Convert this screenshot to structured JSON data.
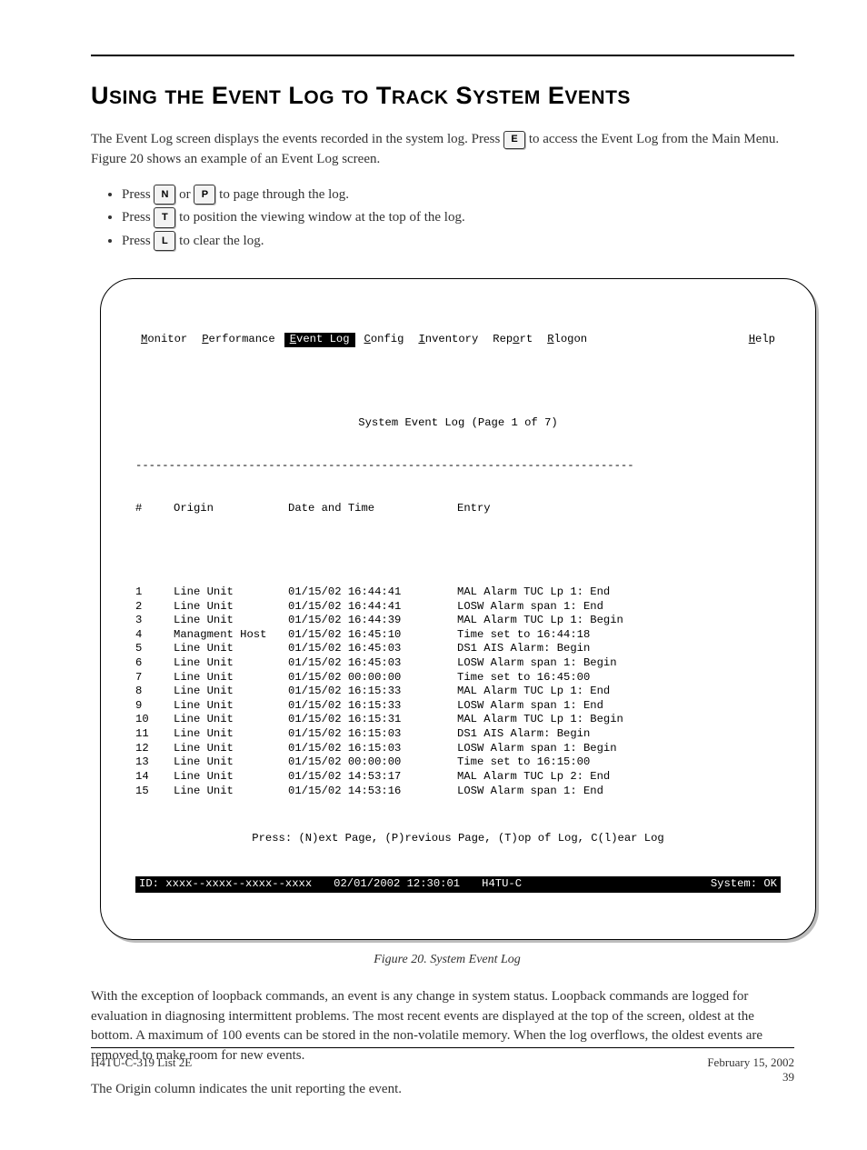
{
  "section_title_html": "U<span class='sc'>SING</span> <span class='sc'>THE</span> E<span class='sc'>VENT</span> L<span class='sc'>OG</span> <span class='sc'>TO</span> T<span class='sc'>RACK</span> S<span class='sc'>YSTEM</span> E<span class='sc'>VENTS</span>",
  "intro": {
    "part1": "The Event Log screen displays the events recorded in the system log. Press ",
    "key1": "E",
    "part2": " to access the Event Log from the Main Menu. Figure 20 shows an example of an Event Log screen."
  },
  "bullets": [
    {
      "pre": "Press ",
      "k1": "N",
      "mid": " or ",
      "k2": "P",
      "post": " to page through the log."
    },
    {
      "pre": "Press ",
      "k1": "T",
      "mid": "",
      "k2": "",
      "post": " to position the viewing window at the top of the log."
    },
    {
      "pre": "Press ",
      "k1": "L",
      "mid": "",
      "k2": "",
      "post": " to clear the log."
    }
  ],
  "terminal": {
    "menu": [
      {
        "label": "Monitor",
        "ul_idx": 0,
        "selected": false
      },
      {
        "label": "Performance",
        "ul_idx": 0,
        "selected": false
      },
      {
        "label": "Event Log",
        "ul_idx": 0,
        "selected": true
      },
      {
        "label": "Config",
        "ul_idx": 0,
        "selected": false
      },
      {
        "label": "Inventory",
        "ul_idx": 0,
        "selected": false
      },
      {
        "label": "Report",
        "ul_idx": 3,
        "selected": false
      },
      {
        "label": "Rlogon",
        "ul_idx": 0,
        "selected": false
      }
    ],
    "help": {
      "label": "Help",
      "ul_idx": 0
    },
    "title": "System Event Log (Page 1 of 7)",
    "columns": {
      "num": "#",
      "origin": "Origin",
      "date": "Date and Time",
      "entry": "Entry"
    },
    "rows": [
      {
        "n": "1",
        "origin": "Line Unit",
        "date": "01/15/02 16:44:41",
        "entry": "MAL Alarm TUC Lp 1: End"
      },
      {
        "n": "2",
        "origin": "Line Unit",
        "date": "01/15/02 16:44:41",
        "entry": "LOSW Alarm span 1: End"
      },
      {
        "n": "3",
        "origin": "Line Unit",
        "date": "01/15/02 16:44:39",
        "entry": "MAL Alarm TUC Lp 1: Begin"
      },
      {
        "n": "4",
        "origin": "Managment Host",
        "date": "01/15/02 16:45:10",
        "entry": "Time set to 16:44:18"
      },
      {
        "n": "5",
        "origin": "Line Unit",
        "date": "01/15/02 16:45:03",
        "entry": "DS1 AIS Alarm: Begin"
      },
      {
        "n": "6",
        "origin": "Line Unit",
        "date": "01/15/02 16:45:03",
        "entry": "LOSW Alarm span 1: Begin"
      },
      {
        "n": "7",
        "origin": "Line Unit",
        "date": "01/15/02 00:00:00",
        "entry": "Time set to 16:45:00"
      },
      {
        "n": "8",
        "origin": "Line Unit",
        "date": "01/15/02 16:15:33",
        "entry": "MAL Alarm TUC Lp 1: End"
      },
      {
        "n": "9",
        "origin": "Line Unit",
        "date": "01/15/02 16:15:33",
        "entry": "LOSW Alarm span 1: End"
      },
      {
        "n": "10",
        "origin": "Line Unit",
        "date": "01/15/02 16:15:31",
        "entry": "MAL Alarm TUC Lp 1: Begin"
      },
      {
        "n": "11",
        "origin": "Line Unit",
        "date": "01/15/02 16:15:03",
        "entry": "DS1 AIS Alarm: Begin"
      },
      {
        "n": "12",
        "origin": "Line Unit",
        "date": "01/15/02 16:15:03",
        "entry": "LOSW Alarm span 1: Begin"
      },
      {
        "n": "13",
        "origin": "Line Unit",
        "date": "01/15/02 00:00:00",
        "entry": "Time set to 16:15:00"
      },
      {
        "n": "14",
        "origin": "Line Unit",
        "date": "01/15/02 14:53:17",
        "entry": "MAL Alarm TUC Lp 2: End"
      },
      {
        "n": "15",
        "origin": "Line Unit",
        "date": "01/15/02 14:53:16",
        "entry": "LOSW Alarm span 1: End"
      }
    ],
    "footer_hint": "Press: (N)ext Page, (P)revious Page, (T)op of Log, C(l)ear Log",
    "status": {
      "id": "ID: xxxx--xxxx--xxxx--xxxx",
      "date": "02/01/2002 12:30:01",
      "model": "H4TU-C",
      "system": "System: OK"
    }
  },
  "figure_caption": "Figure 20.  System Event Log",
  "para2": "With the exception of loopback commands, an event is any change in system status. Loopback commands are logged for evaluation in diagnosing intermittent problems. The most recent events are displayed at the top of the screen, oldest at the bottom. A maximum of 100 events can be stored in the non-volatile memory. When the log overflows, the oldest events are removed to make room for new events.",
  "para3": "The Origin column indicates the unit reporting the event.",
  "footer": {
    "left": "H4TU-C-319 List 2E",
    "right": "February 15, 2002",
    "page": "39"
  }
}
